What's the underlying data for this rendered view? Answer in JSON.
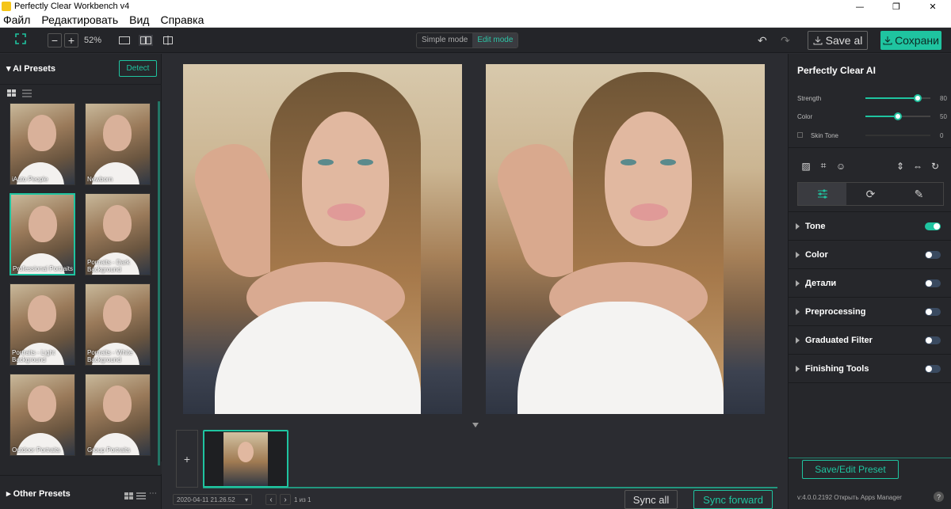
{
  "window": {
    "title": "Perfectly Clear Workbench v4",
    "controls": [
      "—",
      "❐",
      "✕"
    ]
  },
  "menu": [
    "Файл",
    "Редактировать",
    "Вид",
    "Справка"
  ],
  "toolbar": {
    "zoom": "52%",
    "mode_simple": "Simple mode",
    "mode_edit": "Edit mode",
    "save_label": "Save al",
    "save2_label": "Сохрани"
  },
  "left": {
    "presets_title": "AI Presets",
    "detect_label": "Detect",
    "presets": [
      {
        "label": "iAuto People"
      },
      {
        "label": "Newborn"
      },
      {
        "label": "Professional Portraits"
      },
      {
        "label": "Portraits - Dark Background"
      },
      {
        "label": "Portraits - Light Background"
      },
      {
        "label": "Portraits - White Background"
      },
      {
        "label": "Outdoor Portraits"
      },
      {
        "label": "Group Portraits"
      }
    ],
    "other_presets": "Other Presets"
  },
  "center": {
    "date": "2020-04-11 21.26.52",
    "page_info": "1 из 1",
    "sync_all": "Sync all",
    "sync_forward": "Sync forward",
    "add_symbol": "+"
  },
  "right": {
    "title": "Perfectly Clear AI",
    "sliders": [
      {
        "label": "Strength",
        "value": "80",
        "fraction": 0.8
      },
      {
        "label": "Color",
        "value": "50",
        "fraction": 0.5
      },
      {
        "label": "Skin Tone",
        "value": "0",
        "fraction": 0
      }
    ],
    "sections": [
      {
        "label": "Tone",
        "on": true
      },
      {
        "label": "Color",
        "on": false
      },
      {
        "label": "Детали",
        "on": false
      },
      {
        "label": "Preprocessing",
        "on": false
      },
      {
        "label": "Graduated Filter",
        "on": false
      },
      {
        "label": "Finishing Tools",
        "on": false
      }
    ],
    "preset_button": "Save/Edit Preset",
    "version": "v:4.0.0.2192  Открыть Apps Manager",
    "help": "?"
  },
  "colors": {
    "accent": "#1fc4a0",
    "panel": "#26272b",
    "canvas": "#2b2c31"
  }
}
